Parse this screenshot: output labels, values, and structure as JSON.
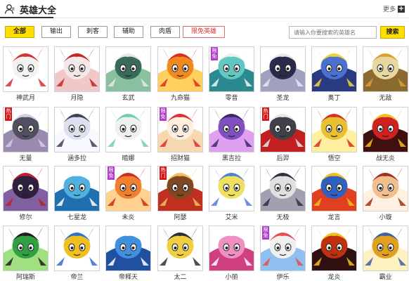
{
  "header": {
    "title": "英雄大全",
    "more_label": "更多",
    "plus_label": "+"
  },
  "filters": [
    {
      "label": "全部",
      "state": "active"
    },
    {
      "label": "输出",
      "state": "normal"
    },
    {
      "label": "刺客",
      "state": "normal"
    },
    {
      "label": "辅助",
      "state": "normal"
    },
    {
      "label": "肉盾",
      "state": "normal"
    },
    {
      "label": "限免英雄",
      "state": "hot"
    }
  ],
  "search": {
    "placeholder": "请输入你要搜索的英雄名",
    "button_label": "搜索"
  },
  "heroes": [
    {
      "name": "神武月",
      "badge": "",
      "colors": [
        "#f2f2f2",
        "#d83030",
        "#ffffff"
      ]
    },
    {
      "name": "月隐",
      "badge": "",
      "colors": [
        "#f5e8e8",
        "#c02828",
        "#f0c8c8"
      ]
    },
    {
      "name": "玄武",
      "badge": "",
      "colors": [
        "#3a6a5a",
        "#e8e8e8",
        "#88c0a0"
      ]
    },
    {
      "name": "九命猫",
      "badge": "",
      "colors": [
        "#f08a20",
        "#d83020",
        "#ffd060"
      ]
    },
    {
      "name": "零音",
      "badge": "限免",
      "colors": [
        "#60c8c0",
        "#f0f0f0",
        "#2a8a90"
      ]
    },
    {
      "name": "圣龙",
      "badge": "",
      "colors": [
        "#2a2a4a",
        "#e8e8f0",
        "#a0a0c0"
      ]
    },
    {
      "name": "奥丁",
      "badge": "",
      "colors": [
        "#4a70d0",
        "#f0d040",
        "#2a3a80"
      ]
    },
    {
      "name": "无敌",
      "badge": "",
      "colors": [
        "#e8d8a0",
        "#d8a030",
        "#8a6a30"
      ]
    },
    {
      "name": "无量",
      "badge": "热门",
      "colors": [
        "#505060",
        "#d0d0e0",
        "#9a8ab0"
      ]
    },
    {
      "name": "涵多拉",
      "badge": "",
      "colors": [
        "#dde0ee",
        "#40405a",
        "#f8f8ff"
      ]
    },
    {
      "name": "暗娜",
      "badge": "",
      "colors": [
        "#f0f0f0",
        "#70d0b0",
        "#ffffff"
      ]
    },
    {
      "name": "招财猫",
      "badge": "限免",
      "colors": [
        "#fff0e0",
        "#e03030",
        "#f8d8b0"
      ]
    },
    {
      "name": "黑吉拉",
      "badge": "",
      "colors": [
        "#8050c0",
        "#3a2a6a",
        "#e0a0f0"
      ]
    },
    {
      "name": "后羿",
      "badge": "热门",
      "colors": [
        "#404048",
        "#e8e8e8",
        "#c02020"
      ]
    },
    {
      "name": "悟空",
      "badge": "",
      "colors": [
        "#e8c030",
        "#d83020",
        "#fff0a0"
      ]
    },
    {
      "name": "战无炎",
      "badge": "",
      "colors": [
        "#d02020",
        "#f0c020",
        "#401010"
      ]
    },
    {
      "name": "修尔",
      "badge": "",
      "colors": [
        "#302040",
        "#c02030",
        "#8060a0"
      ]
    },
    {
      "name": "七星龙",
      "badge": "",
      "colors": [
        "#50b0e0",
        "#ffffff",
        "#2070b0"
      ]
    },
    {
      "name": "未炎",
      "badge": "限免",
      "colors": [
        "#f08030",
        "#c83020",
        "#ffd090"
      ]
    },
    {
      "name": "阿瑟",
      "badge": "热门",
      "colors": [
        "#804820",
        "#f0c060",
        "#c03020"
      ]
    },
    {
      "name": "艾米",
      "badge": "",
      "colors": [
        "#f0e060",
        "#5080d0",
        "#ffffff"
      ]
    },
    {
      "name": "无极",
      "badge": "",
      "colors": [
        "#e0e0e0",
        "#303040",
        "#a0a0b0"
      ]
    },
    {
      "name": "龙言",
      "badge": "",
      "colors": [
        "#3060c0",
        "#f0c020",
        "#e04020"
      ]
    },
    {
      "name": "小璇",
      "badge": "",
      "colors": [
        "#f0c090",
        "#a03020",
        "#fff0e0"
      ]
    },
    {
      "name": "阿瑞斯",
      "badge": "",
      "colors": [
        "#30a040",
        "#202020",
        "#a0e080"
      ]
    },
    {
      "name": "帝兰",
      "badge": "",
      "colors": [
        "#f0c020",
        "#3070d0",
        "#ffffff"
      ]
    },
    {
      "name": "帝释天",
      "badge": "",
      "colors": [
        "#4090e0",
        "#ffffff",
        "#2050a0"
      ]
    },
    {
      "name": "太二",
      "badge": "",
      "colors": [
        "#f0d040",
        "#303030",
        "#ffffff"
      ]
    },
    {
      "name": "小丽",
      "badge": "",
      "colors": [
        "#f090c0",
        "#ffffff",
        "#d04080"
      ]
    },
    {
      "name": "伊乐",
      "badge": "限免",
      "colors": [
        "#f0f0f0",
        "#e05050",
        "#90c0f0"
      ]
    },
    {
      "name": "龙炎",
      "badge": "",
      "colors": [
        "#c03010",
        "#f0c020",
        "#301010"
      ]
    },
    {
      "name": "霸业",
      "badge": "",
      "colors": [
        "#e0a020",
        "#4060a0",
        "#fff0c0"
      ]
    }
  ]
}
